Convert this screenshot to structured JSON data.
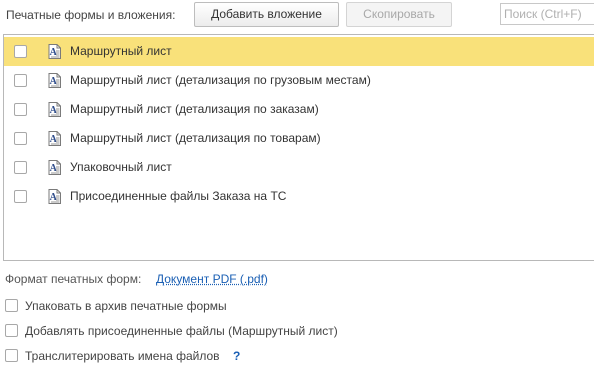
{
  "toolbar": {
    "label": "Печатные формы и вложения:",
    "add_button": "Добавить вложение",
    "copy_button": "Скопировать",
    "search_placeholder": "Поиск (Ctrl+F)"
  },
  "list": {
    "rows": [
      {
        "label": "Маршрутный лист",
        "checked": false,
        "selected": true,
        "icon": "document-text-icon"
      },
      {
        "label": "Маршрутный лист (детализация по грузовым местам)",
        "checked": false,
        "selected": false,
        "icon": "document-text-icon"
      },
      {
        "label": "Маршрутный лист (детализация по заказам)",
        "checked": false,
        "selected": false,
        "icon": "document-text-icon"
      },
      {
        "label": "Маршрутный лист (детализация по товарам)",
        "checked": false,
        "selected": false,
        "icon": "document-text-icon"
      },
      {
        "label": "Упаковочный лист",
        "checked": false,
        "selected": false,
        "icon": "document-text-icon"
      },
      {
        "label": "Присоединенные файлы Заказа на ТС",
        "checked": false,
        "selected": false,
        "icon": "document-text-icon"
      }
    ]
  },
  "format": {
    "label": "Формат печатных форм:",
    "value": "Документ PDF (.pdf)"
  },
  "options": {
    "archive": "Упаковать в архив печатные формы",
    "attach": "Добавлять присоединенные файлы (Маршрутный лист)",
    "transliterate": "Транслитерировать имена файлов",
    "help": "?"
  },
  "colors": {
    "selected_row": "#f9e17a",
    "link": "#1a5fb4"
  }
}
